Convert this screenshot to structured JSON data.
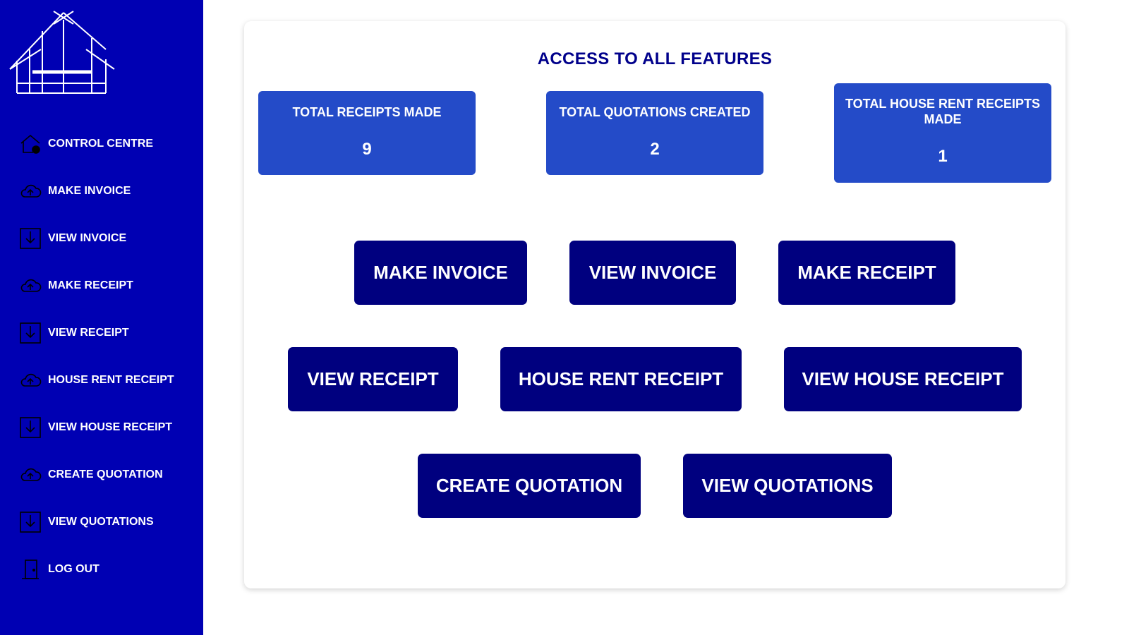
{
  "sidebar": {
    "logo_icon": "house-outline-logo",
    "items": [
      {
        "label": "CONTROL CENTRE",
        "icon": "home-settings-icon"
      },
      {
        "label": "MAKE INVOICE",
        "icon": "cloud-upload-icon"
      },
      {
        "label": "VIEW INVOICE",
        "icon": "download-box-icon"
      },
      {
        "label": "MAKE RECEIPT",
        "icon": "cloud-upload-icon"
      },
      {
        "label": "VIEW RECEIPT",
        "icon": "download-box-icon"
      },
      {
        "label": "HOUSE RENT RECEIPT",
        "icon": "cloud-upload-icon"
      },
      {
        "label": "VIEW HOUSE RECEIPT",
        "icon": "download-box-icon"
      },
      {
        "label": "CREATE QUOTATION",
        "icon": "cloud-upload-icon"
      },
      {
        "label": "VIEW QUOTATIONS",
        "icon": "download-box-icon"
      },
      {
        "label": "LOG OUT",
        "icon": "door-exit-icon"
      }
    ]
  },
  "main": {
    "title": "ACCESS TO ALL FEATURES",
    "stats": [
      {
        "label": "TOTAL RECEIPTS MADE",
        "value": "9"
      },
      {
        "label": "TOTAL QUOTATIONS CREATED",
        "value": "2"
      },
      {
        "label": "TOTAL HOUSE RENT RECEIPTS MADE",
        "value": "1"
      }
    ],
    "buttons": [
      "MAKE INVOICE",
      "VIEW INVOICE",
      "MAKE RECEIPT",
      "VIEW RECEIPT",
      "HOUSE RENT RECEIPT",
      "VIEW HOUSE RECEIPT",
      "CREATE QUOTATION",
      "VIEW QUOTATIONS"
    ]
  },
  "colors": {
    "sidebar_bg": "#0000b3",
    "stat_bg": "#244bc8",
    "button_bg": "#00007f",
    "title_text": "#00008b"
  }
}
